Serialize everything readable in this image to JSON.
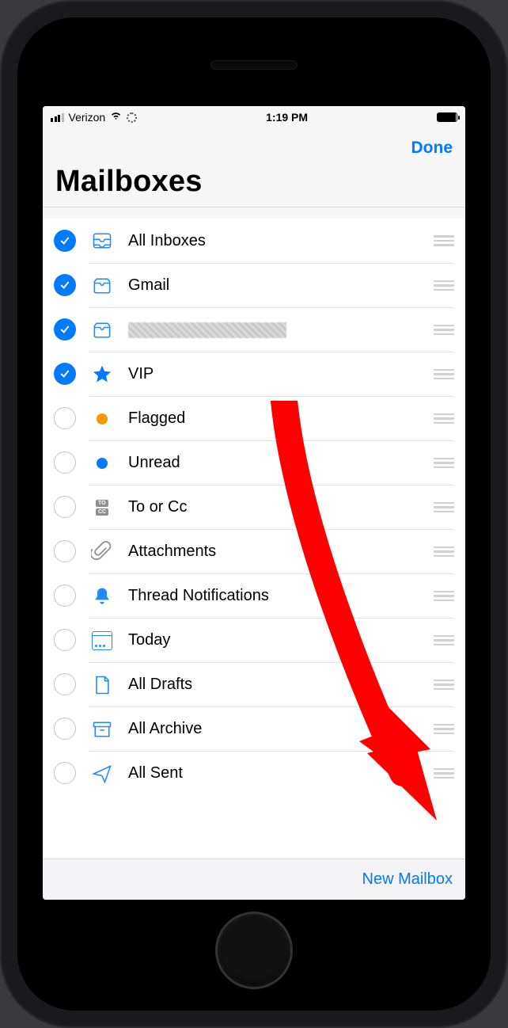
{
  "statusbar": {
    "carrier": "Verizon",
    "time": "1:19 PM"
  },
  "nav": {
    "done": "Done",
    "title": "Mailboxes"
  },
  "rows": [
    {
      "label": "All Inboxes",
      "checked": true,
      "icon": "all-inboxes",
      "name": "row-all-inboxes"
    },
    {
      "label": "Gmail",
      "checked": true,
      "icon": "inbox",
      "name": "row-gmail"
    },
    {
      "label": "",
      "checked": true,
      "icon": "inbox",
      "name": "row-redacted",
      "redacted": true
    },
    {
      "label": "VIP",
      "checked": true,
      "icon": "star",
      "name": "row-vip"
    },
    {
      "label": "Flagged",
      "checked": false,
      "icon": "dot-orange",
      "name": "row-flagged"
    },
    {
      "label": "Unread",
      "checked": false,
      "icon": "dot-blue",
      "name": "row-unread"
    },
    {
      "label": "To or Cc",
      "checked": false,
      "icon": "tocc",
      "name": "row-to-or-cc"
    },
    {
      "label": "Attachments",
      "checked": false,
      "icon": "paperclip",
      "name": "row-attachments"
    },
    {
      "label": "Thread Notifications",
      "checked": false,
      "icon": "bell",
      "name": "row-thread-notifications"
    },
    {
      "label": "Today",
      "checked": false,
      "icon": "today",
      "name": "row-today"
    },
    {
      "label": "All Drafts",
      "checked": false,
      "icon": "draft",
      "name": "row-all-drafts"
    },
    {
      "label": "All Archive",
      "checked": false,
      "icon": "archive",
      "name": "row-all-archive"
    },
    {
      "label": "All Sent",
      "checked": false,
      "icon": "sent",
      "name": "row-all-sent"
    }
  ],
  "toolbar": {
    "newMailbox": "New Mailbox"
  },
  "annotation": {
    "arrowColor": "#ff0000"
  }
}
